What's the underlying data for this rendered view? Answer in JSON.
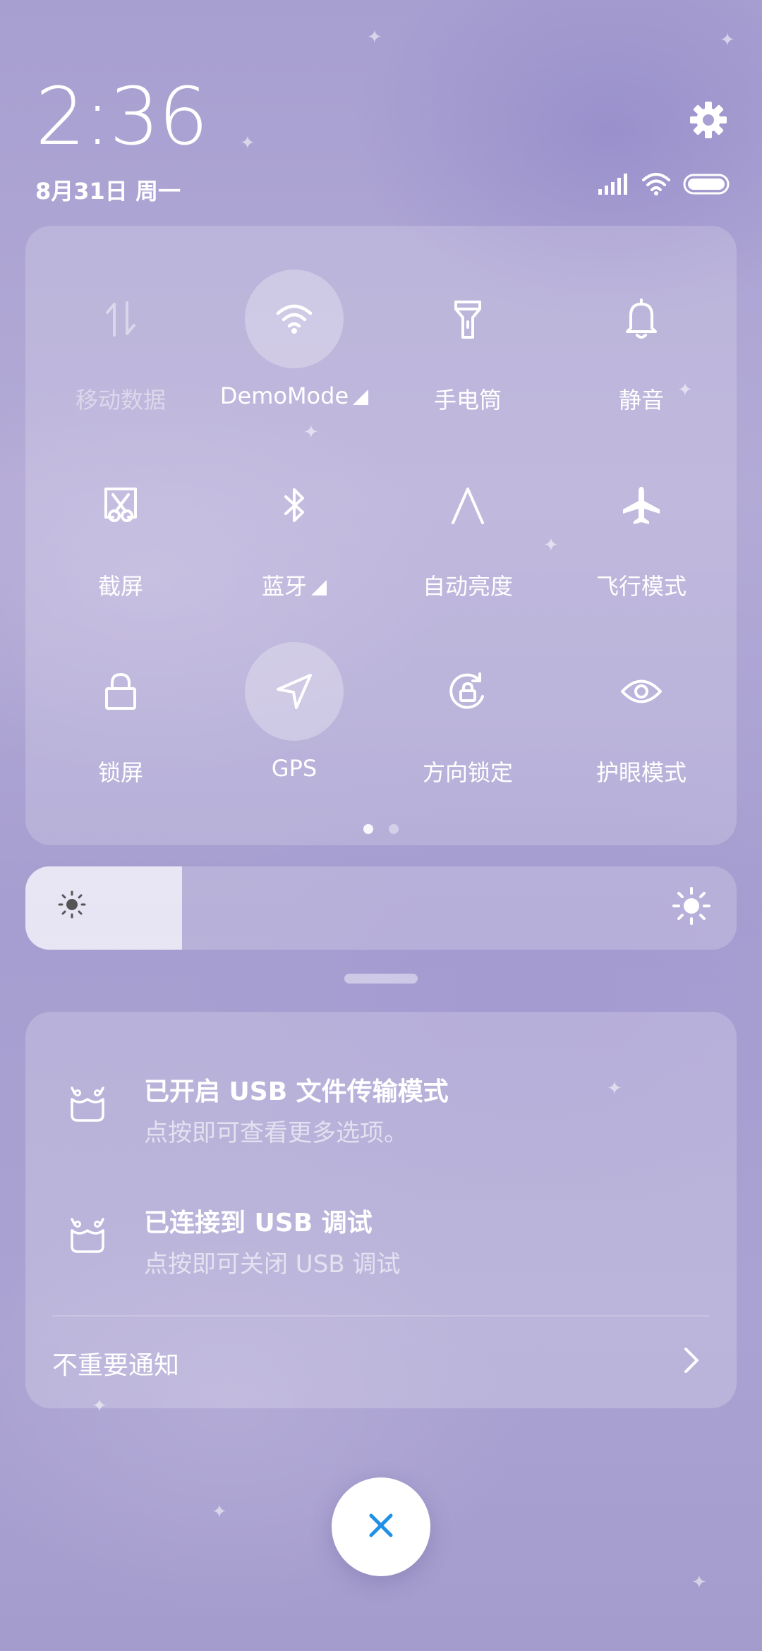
{
  "status": {
    "time": "2:36",
    "date": "8月31日 周一",
    "icons": [
      "signal-icon",
      "wifi-icon",
      "battery-icon"
    ]
  },
  "settings": {
    "icon": "gear-icon"
  },
  "toggles": [
    {
      "label": "移动数据",
      "icon": "mobile-data-icon",
      "active": false,
      "disabled": true
    },
    {
      "label": "DemoMode",
      "icon": "wifi-icon",
      "active": true,
      "has_signal": true
    },
    {
      "label": "手电筒",
      "icon": "flashlight-icon",
      "active": false
    },
    {
      "label": "静音",
      "icon": "bell-icon",
      "active": false
    },
    {
      "label": "截屏",
      "icon": "screenshot-icon",
      "active": false
    },
    {
      "label": "蓝牙",
      "icon": "bluetooth-icon",
      "active": false,
      "has_signal": true
    },
    {
      "label": "自动亮度",
      "icon": "auto-brightness-icon",
      "active": false
    },
    {
      "label": "飞行模式",
      "icon": "airplane-icon",
      "active": false
    },
    {
      "label": "锁屏",
      "icon": "lock-icon",
      "active": false
    },
    {
      "label": "GPS",
      "icon": "location-arrow-icon",
      "active": true
    },
    {
      "label": "方向锁定",
      "icon": "rotation-lock-icon",
      "active": false
    },
    {
      "label": "护眼模式",
      "icon": "eye-icon",
      "active": false
    }
  ],
  "pager": {
    "pages": 2,
    "current": 1
  },
  "brightness": {
    "level": 0.22
  },
  "notifications": [
    {
      "title": "已开启 USB 文件传输模式",
      "subtitle": "点按即可查看更多选项。",
      "icon": "android-usb-icon"
    },
    {
      "title": "已连接到 USB 调试",
      "subtitle": "点按即可关闭 USB 调试",
      "icon": "android-usb-icon"
    }
  ],
  "unimportant": {
    "label": "不重要通知"
  },
  "close": {
    "icon": "close-icon"
  },
  "colors": {
    "accent": "#1e90e6",
    "panel_bg": "#b3aad6"
  }
}
